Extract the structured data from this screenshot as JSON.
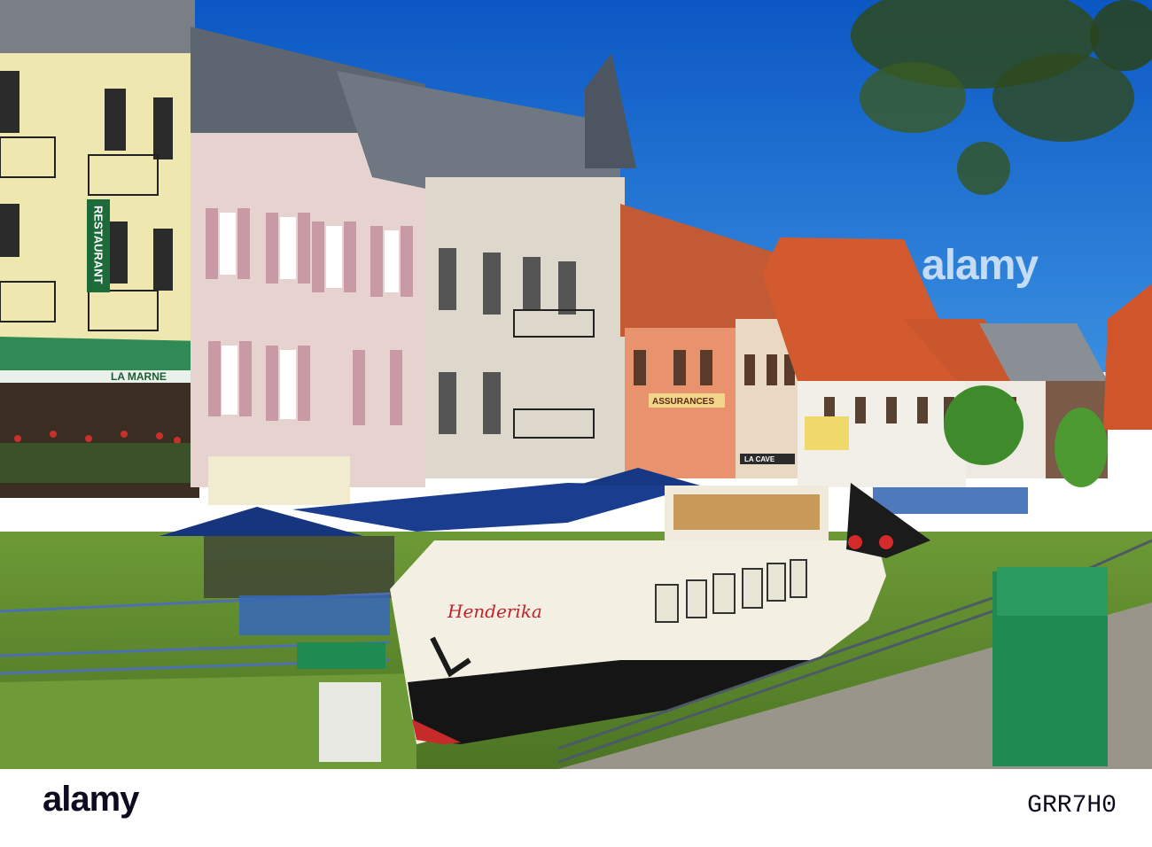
{
  "image": {
    "description_labels": {
      "restaurant_sign": "RESTAURANT",
      "awning_text": "LA MARNE",
      "boat_name": "Henderika",
      "insurance_sign": "ASSURANCES",
      "shop_sign": "LA CAVE"
    }
  },
  "watermark": {
    "text": "alamy"
  },
  "footer": {
    "brand": "alamy",
    "stock_id": "GRR7H0"
  },
  "colors": {
    "sky": "#1f6fd0",
    "water": "#5f8f2f",
    "boat_hull": "#1a1a1a",
    "boat_body": "#f3efe2",
    "awning_blue": "#17357f",
    "roof_orange": "#c9542c"
  }
}
